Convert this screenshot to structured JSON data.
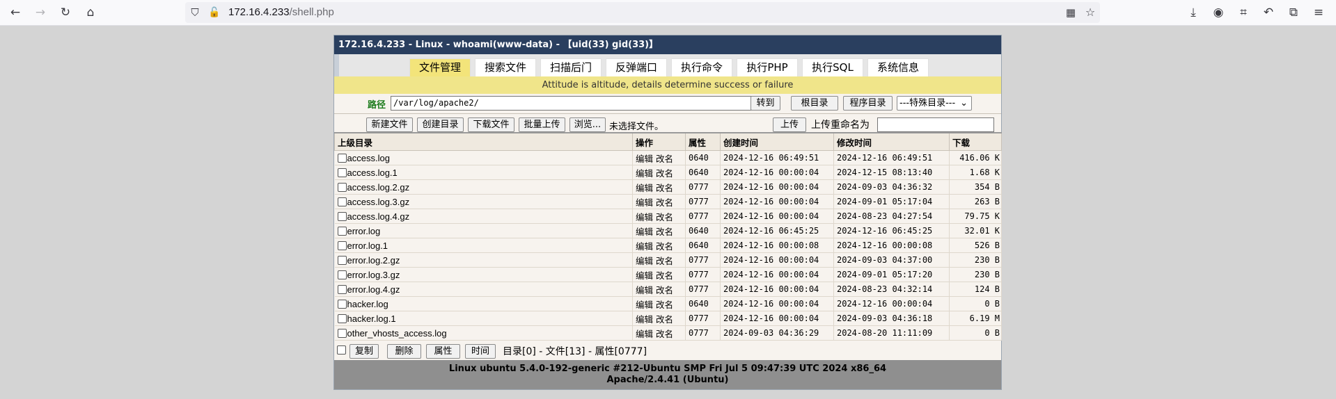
{
  "browser": {
    "url_host": "172.16.4.233",
    "url_path": "/shell.php",
    "icons": [
      "back-icon",
      "forward-icon",
      "reload-icon",
      "home-icon",
      "shield-icon",
      "insecure-lock-icon",
      "qr-code-icon",
      "star-icon",
      "download-icon",
      "account-icon",
      "crop-icon",
      "undo-icon",
      "extensions-icon",
      "menu-icon"
    ]
  },
  "header": {
    "title": "172.16.4.233 - Linux - whoami(www-data) - 【uid(33) gid(33)】"
  },
  "tabs": [
    "文件管理",
    "搜索文件",
    "扫描后门",
    "反弹端口",
    "执行命令",
    "执行PHP",
    "执行SQL",
    "系统信息"
  ],
  "active_tab": "文件管理",
  "motto": "Attitude is altitude, details determine success or failure",
  "path": {
    "label": "路径",
    "value": "/var/log/apache2/",
    "go_button": "转到",
    "root_button": "根目录",
    "program_button": "程序目录",
    "special_select": "---特殊目录---"
  },
  "tools": {
    "new_file": "新建文件",
    "new_dir": "创建目录",
    "download_file": "下载文件",
    "batch_upload": "批量上传",
    "browse": "浏览...",
    "no_file": "未选择文件。",
    "upload": "上传",
    "rename_label": "上传重命名为",
    "rename_value": ""
  },
  "table": {
    "headers": [
      "上级目录",
      "操作",
      "属性",
      "创建时间",
      "修改时间",
      "下载"
    ],
    "rows": [
      {
        "name": "access.log",
        "ops": "编辑 改名",
        "perm": "0640",
        "created": "2024-12-16 06:49:51",
        "modified": "2024-12-16 06:49:51",
        "size": "416.06 K"
      },
      {
        "name": "access.log.1",
        "ops": "编辑 改名",
        "perm": "0640",
        "created": "2024-12-16 00:00:04",
        "modified": "2024-12-15 08:13:40",
        "size": "1.68 K"
      },
      {
        "name": "access.log.2.gz",
        "ops": "编辑 改名",
        "perm": "0777",
        "created": "2024-12-16 00:00:04",
        "modified": "2024-09-03 04:36:32",
        "size": "354 B"
      },
      {
        "name": "access.log.3.gz",
        "ops": "编辑 改名",
        "perm": "0777",
        "created": "2024-12-16 00:00:04",
        "modified": "2024-09-01 05:17:04",
        "size": "263 B"
      },
      {
        "name": "access.log.4.gz",
        "ops": "编辑 改名",
        "perm": "0777",
        "created": "2024-12-16 00:00:04",
        "modified": "2024-08-23 04:27:54",
        "size": "79.75 K"
      },
      {
        "name": "error.log",
        "ops": "编辑 改名",
        "perm": "0640",
        "created": "2024-12-16 06:45:25",
        "modified": "2024-12-16 06:45:25",
        "size": "32.01 K"
      },
      {
        "name": "error.log.1",
        "ops": "编辑 改名",
        "perm": "0640",
        "created": "2024-12-16 00:00:08",
        "modified": "2024-12-16 00:00:08",
        "size": "526 B"
      },
      {
        "name": "error.log.2.gz",
        "ops": "编辑 改名",
        "perm": "0777",
        "created": "2024-12-16 00:00:04",
        "modified": "2024-09-03 04:37:00",
        "size": "230 B"
      },
      {
        "name": "error.log.3.gz",
        "ops": "编辑 改名",
        "perm": "0777",
        "created": "2024-12-16 00:00:04",
        "modified": "2024-09-01 05:17:20",
        "size": "230 B"
      },
      {
        "name": "error.log.4.gz",
        "ops": "编辑 改名",
        "perm": "0777",
        "created": "2024-12-16 00:00:04",
        "modified": "2024-08-23 04:32:14",
        "size": "124 B"
      },
      {
        "name": "hacker.log",
        "ops": "编辑 改名",
        "perm": "0640",
        "created": "2024-12-16 00:00:04",
        "modified": "2024-12-16 00:00:04",
        "size": "0 B"
      },
      {
        "name": "hacker.log.1",
        "ops": "编辑 改名",
        "perm": "0777",
        "created": "2024-12-16 00:00:04",
        "modified": "2024-09-03 04:36:18",
        "size": "6.19 M"
      },
      {
        "name": "other_vhosts_access.log",
        "ops": "编辑 改名",
        "perm": "0777",
        "created": "2024-09-03 04:36:29",
        "modified": "2024-08-20 11:11:09",
        "size": "0 B"
      }
    ]
  },
  "bottom": {
    "copy": "复制",
    "delete": "删除",
    "attr": "属性",
    "time": "时间",
    "summary": "目录[0] - 文件[13] - 属性[0777]"
  },
  "footer": {
    "line1": "Linux ubuntu 5.4.0-192-generic #212-Ubuntu SMP Fri Jul 5 09:47:39 UTC 2024 x86_64",
    "line2": "Apache/2.4.41 (Ubuntu)"
  }
}
